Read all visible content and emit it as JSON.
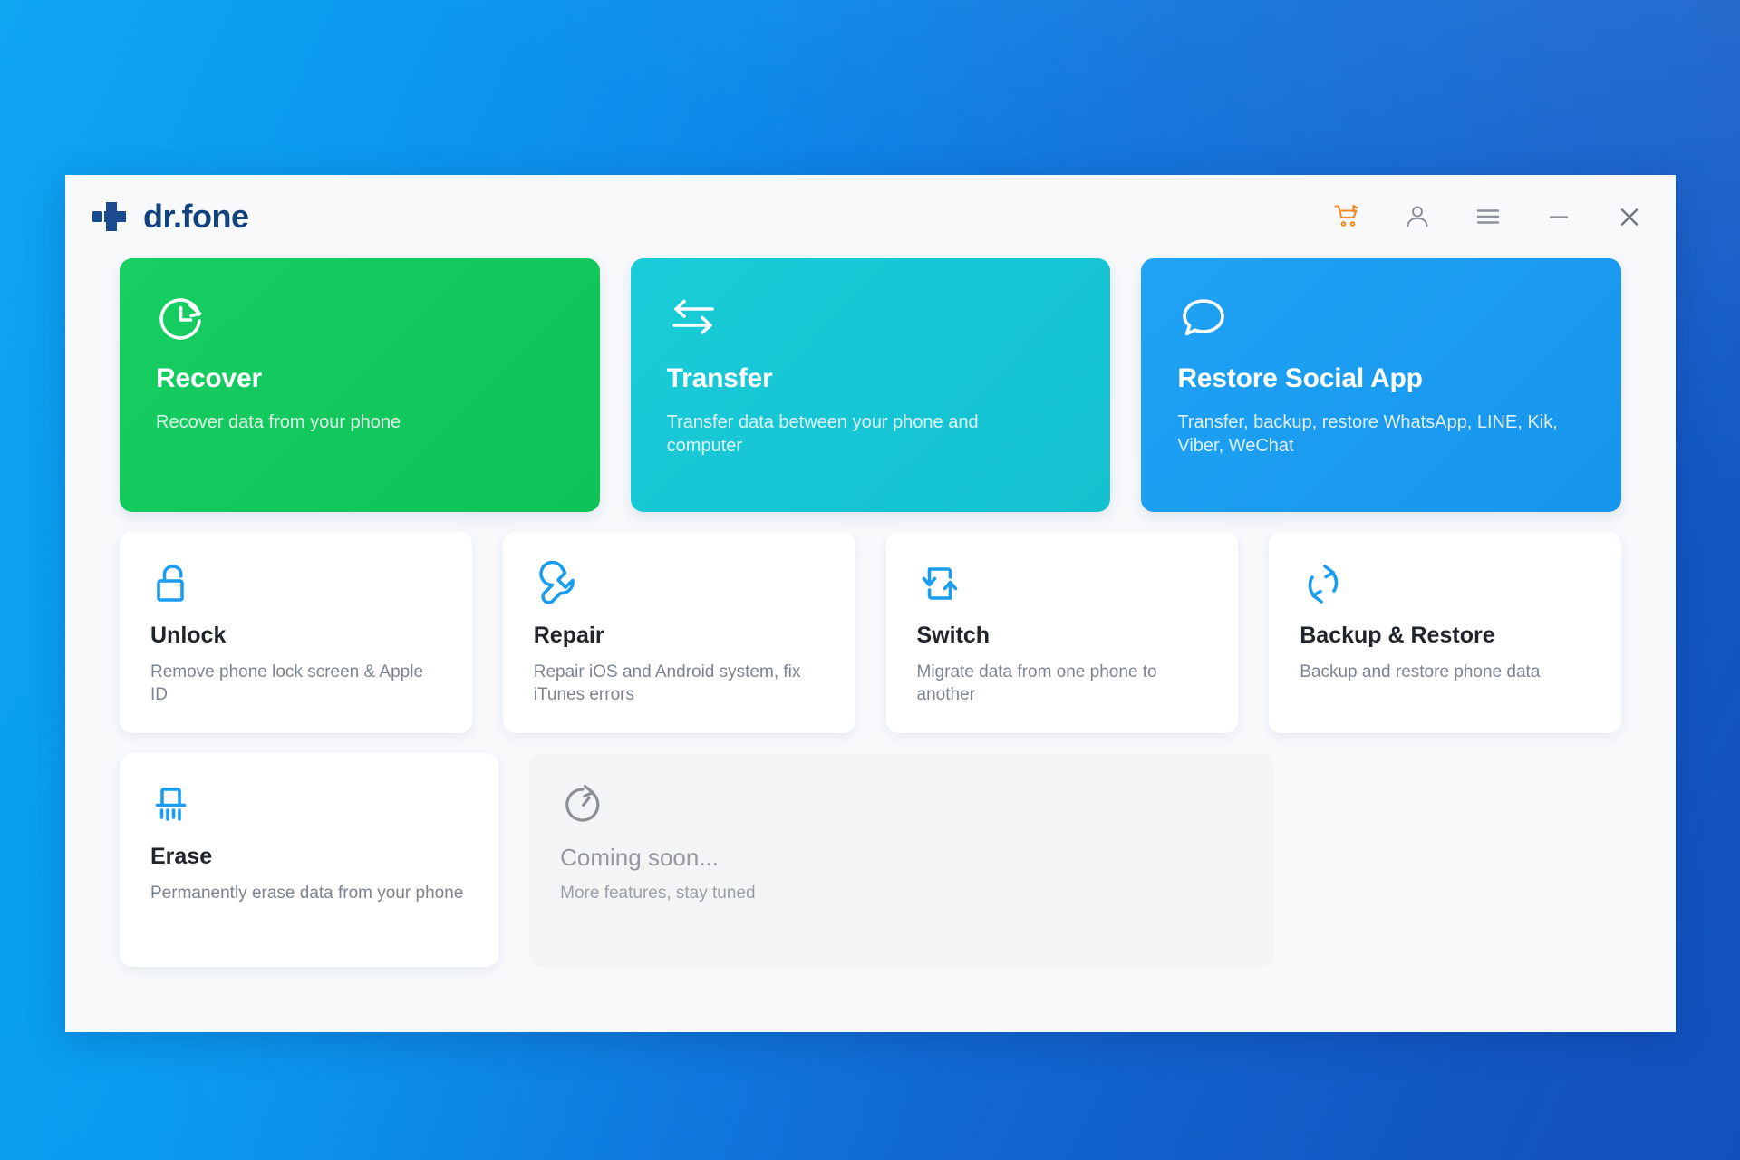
{
  "window": {
    "brand_name": "dr.fone",
    "brand_icon": "cross-plus-logo-icon"
  },
  "titlebar_actions": [
    {
      "name": "cart-icon",
      "label": "Shopping cart",
      "color": "#f08a24"
    },
    {
      "name": "account-icon",
      "label": "Account",
      "color": "#8b9199"
    },
    {
      "name": "menu-icon",
      "label": "Menu",
      "color": "#8b9199"
    },
    {
      "name": "minimize-icon",
      "label": "Minimize",
      "color": "#8b9199"
    },
    {
      "name": "close-icon",
      "label": "Close",
      "color": "#6f757d"
    }
  ],
  "hero_cards": [
    {
      "title": "Recover",
      "desc": "Recover data from your phone",
      "icon": "clock-restore-icon",
      "color": "#13ca5f",
      "color_end": "#0fc75c"
    },
    {
      "title": "Transfer",
      "desc": "Transfer data between your phone and computer",
      "icon": "transfer-arrows-icon",
      "color": "#17c6d4",
      "color_end": "#14c3d2"
    },
    {
      "title": "Restore Social App",
      "desc": "Transfer, backup, restore WhatsApp, LINE, Kik, Viber, WeChat",
      "icon": "chat-bubble-icon",
      "color": "#1a9df0",
      "color_end": "#1898ee"
    }
  ],
  "tile_cards": [
    {
      "title": "Unlock",
      "desc": "Remove phone lock screen & Apple ID",
      "icon": "unlock-padlock-icon",
      "color": "#1a9df0"
    },
    {
      "title": "Repair",
      "desc": "Repair iOS and Android system, fix iTunes errors",
      "icon": "wrench-icon",
      "color": "#1a9df0"
    },
    {
      "title": "Switch",
      "desc": "Migrate data from one phone to another",
      "icon": "phone-switch-icon",
      "color": "#1a9df0"
    },
    {
      "title": "Backup & Restore",
      "desc": "Backup and restore phone data",
      "icon": "sync-circle-icon",
      "color": "#1a9df0"
    }
  ],
  "low_cards": [
    {
      "title": "Erase",
      "desc": "Permanently erase data from your phone",
      "icon": "shredder-icon",
      "color": "#1a9df0"
    }
  ],
  "coming_soon": {
    "title": "Coming soon...",
    "desc": "More features, stay tuned",
    "icon": "stopwatch-icon",
    "color": "#8a9096"
  }
}
